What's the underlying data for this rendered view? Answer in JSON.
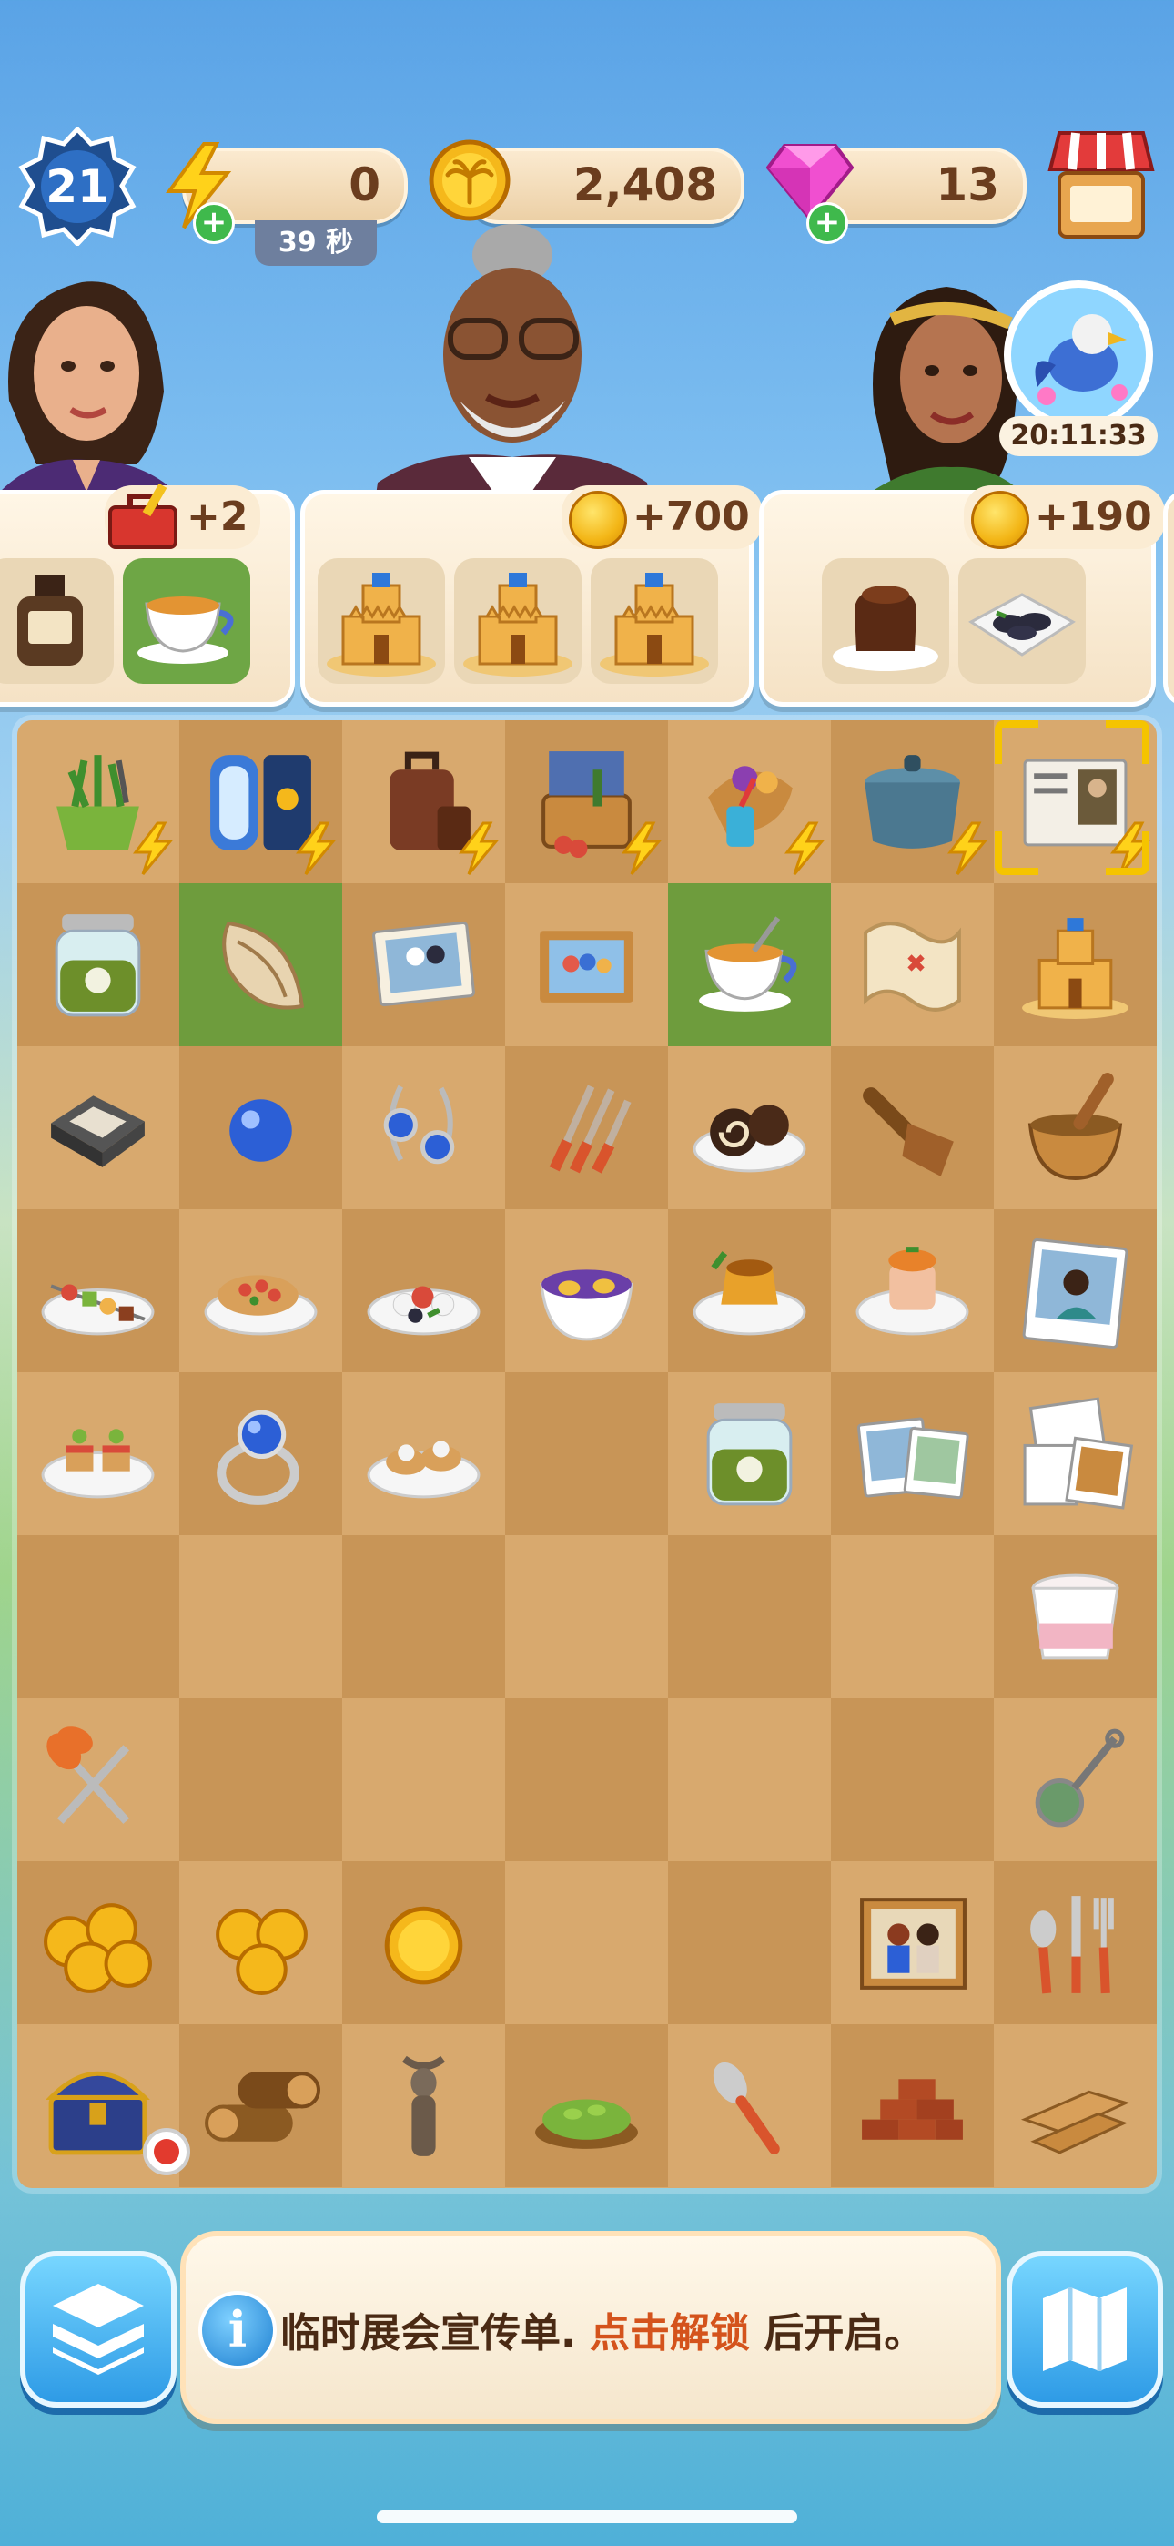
{
  "hud": {
    "level": "21",
    "energy": {
      "value": "0",
      "timer": "39 秒"
    },
    "coins": {
      "value": "2,408"
    },
    "gems": {
      "value": "13"
    },
    "icons": {
      "energy": "lightning-icon",
      "coins": "palm-coin-icon",
      "gems": "pink-gem-icon",
      "shop": "shop-stall-icon"
    }
  },
  "event": {
    "timer": "20:11:33"
  },
  "orders": [
    {
      "reward": "+2",
      "reward_icon": "toolbox-icon",
      "items": [
        "ink-bottle",
        "tea-cup"
      ]
    },
    {
      "reward": "+700",
      "reward_icon": "palm-coin-icon",
      "items": [
        "sandcastle",
        "sandcastle",
        "sandcastle"
      ]
    },
    {
      "reward": "+190",
      "reward_icon": "palm-coin-icon",
      "items": [
        "chocolate-lava-cake",
        "mussels-plate"
      ]
    }
  ],
  "board": {
    "rows": [
      [
        "plant-basket",
        "mirror-screen",
        "luggage",
        "picnic-basket",
        "beach-bucket-cornucopia",
        "cooking-pot",
        "art-magazine"
      ],
      [
        "tea-jar",
        "seashell",
        "wedding-photo",
        "family-photo",
        "tea-cup",
        "treasure-map",
        "sandcastle"
      ],
      [
        "camera-photo-box",
        "blue-bead",
        "sapphire-earrings",
        "cutlery-set",
        "swiss-roll",
        "wooden-scoop",
        "mortar-pestle"
      ],
      [
        "kebab-plate",
        "bruschetta-plate",
        "caprese-plate",
        "berry-egg-bowl",
        "flan-plate",
        "persimmon-dessert",
        "polaroid-portrait"
      ],
      [
        "canape-plate",
        "sapphire-ring",
        "tartlet-plate",
        "",
        "tea-jar-small",
        "photo-pair",
        "photo-stack"
      ],
      [
        "",
        "",
        "",
        "",
        "",
        "",
        "yogurt-cup"
      ],
      [
        "scissors",
        "",
        "",
        "",
        "",
        "",
        "tea-strainer"
      ],
      [
        "coin-pile-large",
        "coin-pile-medium",
        "single-coin",
        "",
        "",
        "painting-couple",
        "cutlery-trio"
      ],
      [
        "treasure-chest",
        "firewood-logs",
        "wooden-idol",
        "green-tea-leaves",
        "spoon",
        "brick-pile",
        "wooden-planks"
      ]
    ]
  },
  "bottom": {
    "inventory_button": "inventory-box-icon",
    "map_button": "map-icon",
    "message_part1": "临时展会宣传单.",
    "message_link": "点击解锁",
    "message_part2": "后开启。"
  },
  "colors": {
    "board_light": "#d8a96e",
    "board_dark": "#c89557",
    "board_done": "#6e9c3d",
    "link": "#d4531c"
  }
}
